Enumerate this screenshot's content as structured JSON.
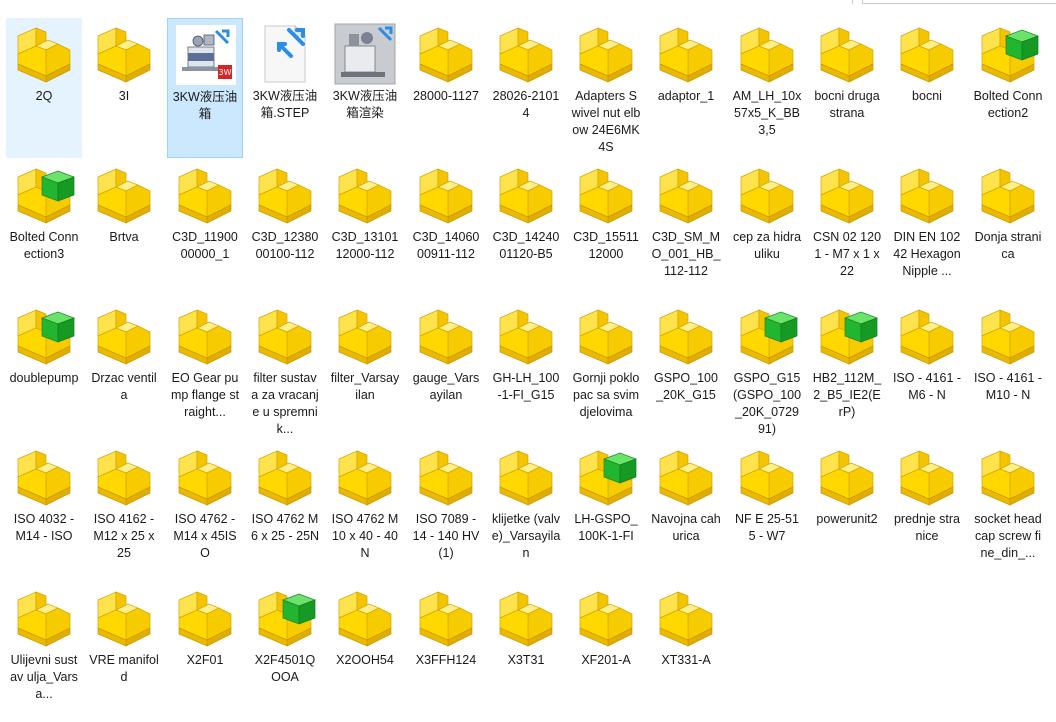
{
  "window": {
    "type": "file-explorer-large-icons"
  },
  "colors": {
    "selected": "#cce8ff",
    "hover": "#e5f3ff",
    "folder_yellow": "#ffd800",
    "green_cube": "#21b530"
  },
  "files": [
    {
      "label": "2Q",
      "icon": "solidworks-part-icon",
      "state": "hover"
    },
    {
      "label": "3I",
      "icon": "solidworks-part-icon"
    },
    {
      "label": "3KW液压油箱",
      "icon": "assembly-thumbnail-icon",
      "state": "selected"
    },
    {
      "label": "3KW液压油箱.STEP",
      "icon": "step-file-icon"
    },
    {
      "label": "3KW液压油箱渲染",
      "icon": "render-thumbnail-icon"
    },
    {
      "label": "28000-1127",
      "icon": "solidworks-part-icon"
    },
    {
      "label": "28026-21014",
      "icon": "solidworks-part-icon"
    },
    {
      "label": "Adapters Swivel nut elbow 24E6MK4S",
      "icon": "solidworks-part-icon"
    },
    {
      "label": "adaptor_1",
      "icon": "solidworks-part-icon"
    },
    {
      "label": "AM_LH_10x57x5_K_BB3,5",
      "icon": "solidworks-part-icon"
    },
    {
      "label": "bocni druga strana",
      "icon": "solidworks-part-icon"
    },
    {
      "label": "bocni",
      "icon": "solidworks-part-icon"
    },
    {
      "label": "Bolted Connection2",
      "icon": "solidworks-assembly-icon"
    },
    {
      "label": "Bolted Connection3",
      "icon": "solidworks-assembly-icon"
    },
    {
      "label": "Brtva",
      "icon": "solidworks-part-icon"
    },
    {
      "label": "C3D_1190000000_1",
      "icon": "solidworks-part-icon"
    },
    {
      "label": "C3D_1238000100-112",
      "icon": "solidworks-part-icon"
    },
    {
      "label": "C3D_1310112000-112",
      "icon": "solidworks-part-icon"
    },
    {
      "label": "C3D_1406000911-112",
      "icon": "solidworks-part-icon"
    },
    {
      "label": "C3D_1424001120-B5",
      "icon": "solidworks-part-icon"
    },
    {
      "label": "C3D_1551112000",
      "icon": "solidworks-part-icon"
    },
    {
      "label": "C3D_SM_MO_001_HB_112-112",
      "icon": "solidworks-part-icon"
    },
    {
      "label": "cep za hidrauliku",
      "icon": "solidworks-part-icon"
    },
    {
      "label": "CSN 02 1201 - M7 x 1 x 22",
      "icon": "solidworks-part-icon"
    },
    {
      "label": "DIN EN 10242 Hexagon Nipple ...",
      "icon": "solidworks-part-icon"
    },
    {
      "label": "Donja stranica",
      "icon": "solidworks-part-icon"
    },
    {
      "label": "doublepump",
      "icon": "solidworks-assembly-icon"
    },
    {
      "label": "Drzac ventila",
      "icon": "solidworks-part-icon"
    },
    {
      "label": "EO Gear pump flange straight...",
      "icon": "solidworks-part-icon"
    },
    {
      "label": "filter sustava za vracanje u spremnik...",
      "icon": "solidworks-part-icon"
    },
    {
      "label": "filter_Varsayilan",
      "icon": "solidworks-part-icon"
    },
    {
      "label": "gauge_Varsayilan",
      "icon": "solidworks-part-icon"
    },
    {
      "label": "GH-LH_100-1-FI_G15",
      "icon": "solidworks-part-icon"
    },
    {
      "label": "Gornji poklopac sa svim djelovima",
      "icon": "solidworks-part-icon"
    },
    {
      "label": "GSPO_100_20K_G15",
      "icon": "solidworks-part-icon"
    },
    {
      "label": "GSPO_G15(GSPO_100_20K_072991)",
      "icon": "solidworks-assembly-icon"
    },
    {
      "label": "HB2_112M_2_B5_IE2(ErP)",
      "icon": "solidworks-assembly-icon"
    },
    {
      "label": "ISO - 4161 - M6 - N",
      "icon": "solidworks-part-icon"
    },
    {
      "label": "ISO - 4161 - M10 - N",
      "icon": "solidworks-part-icon"
    },
    {
      "label": "ISO 4032 - M14 - ISO",
      "icon": "solidworks-part-icon"
    },
    {
      "label": "ISO 4162 - M12 x 25 x 25",
      "icon": "solidworks-part-icon"
    },
    {
      "label": "ISO 4762 - M14 x 45ISO",
      "icon": "solidworks-part-icon"
    },
    {
      "label": "ISO 4762 M6 x 25 - 25N",
      "icon": "solidworks-part-icon"
    },
    {
      "label": "ISO 4762 M10 x 40 - 40N",
      "icon": "solidworks-part-icon"
    },
    {
      "label": "ISO 7089 - 14 - 140 HV(1)",
      "icon": "solidworks-part-icon"
    },
    {
      "label": "klijetke (valve)_Varsayilan",
      "icon": "solidworks-part-icon"
    },
    {
      "label": "LH-GSPO_100K-1-FI",
      "icon": "solidworks-assembly-icon"
    },
    {
      "label": "Navojna cahurica",
      "icon": "solidworks-part-icon"
    },
    {
      "label": "NF E 25-515 - W7",
      "icon": "solidworks-part-icon"
    },
    {
      "label": "powerunit2",
      "icon": "solidworks-part-icon"
    },
    {
      "label": "prednje stranice",
      "icon": "solidworks-part-icon"
    },
    {
      "label": "socket head cap screw fine_din_...",
      "icon": "solidworks-part-icon"
    },
    {
      "label": "Ulijevni sustav ulja_Varsa...",
      "icon": "solidworks-part-icon"
    },
    {
      "label": "VRE manifold",
      "icon": "solidworks-part-icon"
    },
    {
      "label": "X2F01",
      "icon": "solidworks-part-icon"
    },
    {
      "label": "X2F4501QOOA",
      "icon": "solidworks-assembly-icon"
    },
    {
      "label": "X2OOH54",
      "icon": "solidworks-part-icon"
    },
    {
      "label": "X3FFH124",
      "icon": "solidworks-part-icon"
    },
    {
      "label": "X3T31",
      "icon": "solidworks-part-icon"
    },
    {
      "label": "XF201-A",
      "icon": "solidworks-part-icon"
    },
    {
      "label": "XT331-A",
      "icon": "solidworks-part-icon"
    }
  ]
}
